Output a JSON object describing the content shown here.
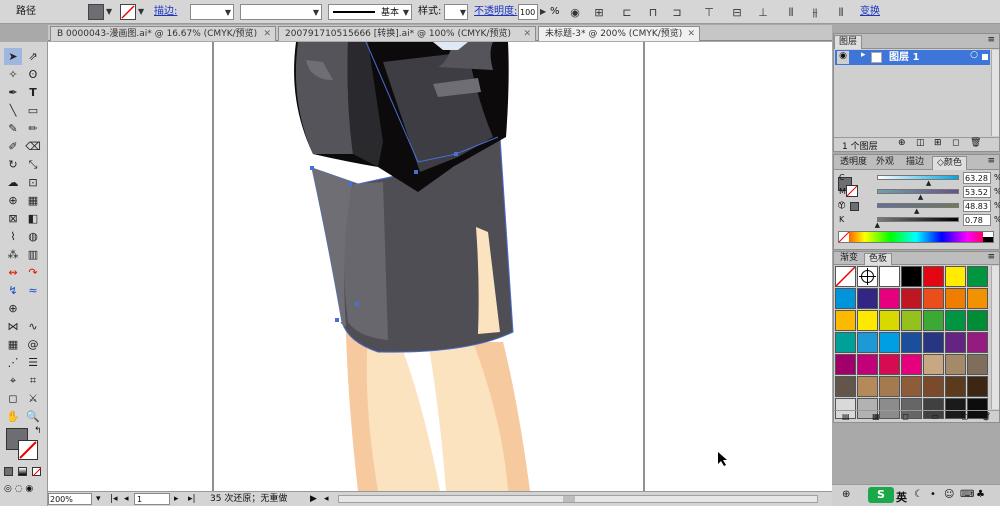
{
  "control_bar": {
    "path_label": "路径",
    "stroke_label": "描边:",
    "stroke_profile": "基本",
    "style_label": "样式:",
    "opacity_label": "不透明度:",
    "opacity_value": "100",
    "opacity_unit": "%",
    "transform_link": "变换"
  },
  "tabs": [
    {
      "label": "B 0000043-漫画图.ai* @ 16.67% (CMYK/预览)",
      "active": false
    },
    {
      "label": "2007917105156​66 [转换].ai* @ 100% (CMYK/预览)",
      "active": false
    },
    {
      "label": "未标题-3* @ 200% (CMYK/预览)",
      "active": true
    }
  ],
  "status_bar": {
    "zoom": "200%",
    "artboard": "1",
    "history": "35 次还原；无重做"
  },
  "layers_panel": {
    "title": "图层",
    "layer_name": "图层 1",
    "count": "1 个图层"
  },
  "color_panel": {
    "tabs": [
      "透明度",
      "外观",
      "描边",
      "颜色"
    ],
    "active_tab": "颜色",
    "sliders": [
      {
        "label": "C",
        "value": "63.28",
        "fraction": 0.6328,
        "gradient": [
          "#ffffff",
          "#00a6e5"
        ]
      },
      {
        "label": "M",
        "value": "53.52",
        "fraction": 0.5352,
        "gradient": [
          "#6da3ac",
          "#6d4f87"
        ]
      },
      {
        "label": "Y",
        "value": "48.83",
        "fraction": 0.4883,
        "gradient": [
          "#626f9c",
          "#6f7a59"
        ]
      },
      {
        "label": "K",
        "value": "0.78",
        "fraction": 0.0078,
        "gradient": [
          "#7b7b7b",
          "#000000"
        ]
      }
    ],
    "percent": "%"
  },
  "swatches_panel": {
    "tabs": [
      "渐变",
      "色板"
    ],
    "active_tab": "色板",
    "colors": [
      "none",
      "registration",
      "#ffffff",
      "#000000",
      "#e30613",
      "#ffec00",
      "#009640",
      "#0095da",
      "#312783",
      "#e6007e",
      "#be1622",
      "#e94e1b",
      "#ef7d00",
      "#f39200",
      "#fbba00",
      "#ffe800",
      "#d8d900",
      "#95c11f",
      "#3aaa35",
      "#009540",
      "#008d36",
      "#00a099",
      "#1d9ad6",
      "#009fe3",
      "#1b4f9c",
      "#283583",
      "#662482",
      "#951b81",
      "#a1006b",
      "#c2007a",
      "#d60b52",
      "#e6007e",
      "#c8a882",
      "#a58a69",
      "#806e5c",
      "#61554c",
      "#b48a5b",
      "#a37b4e",
      "#8f5c3a",
      "#7a4a2a",
      "#5c3a1e",
      "#3d2612",
      "#d9d9d9",
      "#b2b2b2",
      "#8c8c8c",
      "#666666",
      "#404040",
      "#1a1a1a",
      "#0d0d0d"
    ]
  },
  "taskbar": {
    "ime": "英"
  },
  "colors": {
    "fill": "#6d6e72",
    "skirt_main": "#4f4e54",
    "skirt_light": "#6f6e74",
    "jacket_dark": "#0c0a0b",
    "skin_light": "#fbe3c0",
    "skin_shadow": "#f6c99f",
    "selection": "#4a6ed4"
  }
}
